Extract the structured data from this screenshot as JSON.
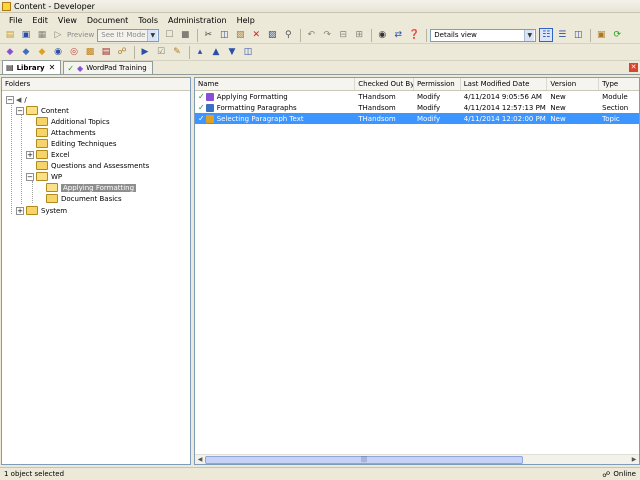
{
  "window": {
    "title": "Content - Developer"
  },
  "menu": [
    "File",
    "Edit",
    "View",
    "Document",
    "Tools",
    "Administration",
    "Help"
  ],
  "toolbar1": {
    "preview_label": "Preview",
    "mode_value": "See It! Mode",
    "view_select_value": "Details view"
  },
  "tabs": [
    {
      "label": "Library",
      "icon": "library-icon",
      "active": true
    },
    {
      "label": "WordPad Training",
      "icon": "module-icon",
      "active": false
    }
  ],
  "folders": {
    "header": "Folders",
    "tree": [
      {
        "label": "/",
        "depth": 0,
        "expander": "-",
        "icon": "library-root-icon",
        "selected": false
      },
      {
        "label": "Content",
        "depth": 1,
        "expander": "-",
        "icon": "folder-open-icon",
        "selected": false
      },
      {
        "label": "Additional Topics",
        "depth": 2,
        "expander": "",
        "icon": "folder-icon",
        "selected": false
      },
      {
        "label": "Attachments",
        "depth": 2,
        "expander": "",
        "icon": "folder-icon",
        "selected": false
      },
      {
        "label": "Editing Techniques",
        "depth": 2,
        "expander": "",
        "icon": "folder-icon",
        "selected": false
      },
      {
        "label": "Excel",
        "depth": 2,
        "expander": "+",
        "icon": "folder-icon",
        "selected": false
      },
      {
        "label": "Questions and Assessments",
        "depth": 2,
        "expander": "",
        "icon": "folder-icon",
        "selected": false
      },
      {
        "label": "WP",
        "depth": 2,
        "expander": "-",
        "icon": "folder-open-icon",
        "selected": false
      },
      {
        "label": "Applying Formatting",
        "depth": 3,
        "expander": "",
        "icon": "folder-open-icon",
        "selected": true
      },
      {
        "label": "Document Basics",
        "depth": 3,
        "expander": "",
        "icon": "folder-icon",
        "selected": false
      },
      {
        "label": "System",
        "depth": 1,
        "expander": "+",
        "icon": "folder-icon",
        "selected": false
      }
    ]
  },
  "content": {
    "columns": [
      "Name",
      "Checked Out By",
      "Permission",
      "Last Modified Date",
      "Version",
      "Type"
    ],
    "rows": [
      {
        "name": "Applying Formatting",
        "checked_out_by": "THandsom",
        "permission": "Modify",
        "last_modified": "4/11/2014 9:05:56 AM",
        "version": "New",
        "type": "Module",
        "icon": "module-icon",
        "icon_color": "#8a4fd8",
        "selected": false
      },
      {
        "name": "Formatting Paragraphs",
        "checked_out_by": "THandsom",
        "permission": "Modify",
        "last_modified": "4/11/2014 12:57:13 PM",
        "version": "New",
        "type": "Section",
        "icon": "section-icon",
        "icon_color": "#3b6fc4",
        "selected": false
      },
      {
        "name": "Selecting Paragraph Text",
        "checked_out_by": "THandsom",
        "permission": "Modify",
        "last_modified": "4/11/2014 12:02:00 PM",
        "version": "New",
        "type": "Topic",
        "icon": "topic-icon",
        "icon_color": "#e0a020",
        "selected": true
      }
    ]
  },
  "status": {
    "left": "1 object selected",
    "right": "Online"
  },
  "colors": {
    "selection": "#3d95ff",
    "tree_selection": "#8e8e8e",
    "chrome": "#ece9d8"
  }
}
